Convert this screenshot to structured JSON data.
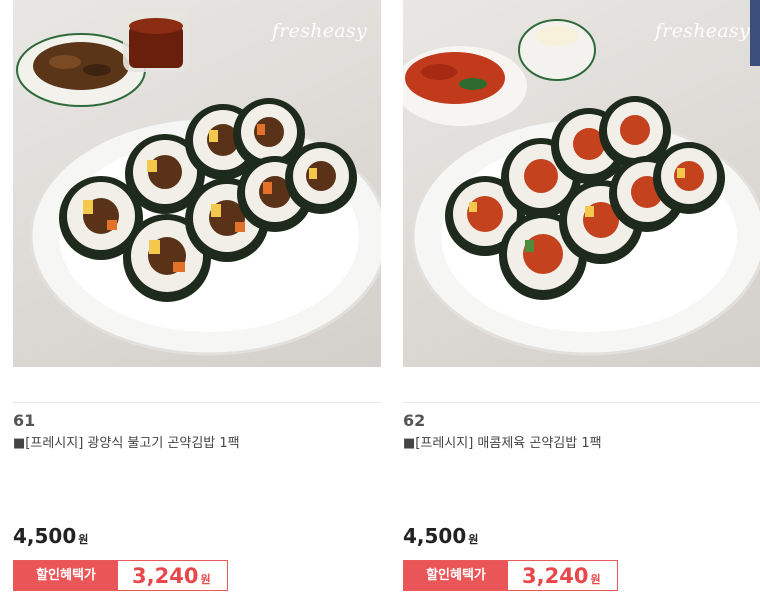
{
  "products": [
    {
      "number": "61",
      "name": "■[프레시지] 광양식 불고기 곤약김밥 1팩",
      "price": "4,500",
      "currency": "원",
      "discount_label": "할인혜택가",
      "discount_price": "3,240",
      "brand": "fresheasy"
    },
    {
      "number": "62",
      "name": "■[프레시지] 매콤제육 곤약김밥 1팩",
      "price": "4,500",
      "currency": "원",
      "discount_label": "할인혜택가",
      "discount_price": "3,240",
      "brand": "fresheasy"
    }
  ],
  "colors": {
    "discount_red": "#ea5557",
    "text_dark": "#222222"
  }
}
